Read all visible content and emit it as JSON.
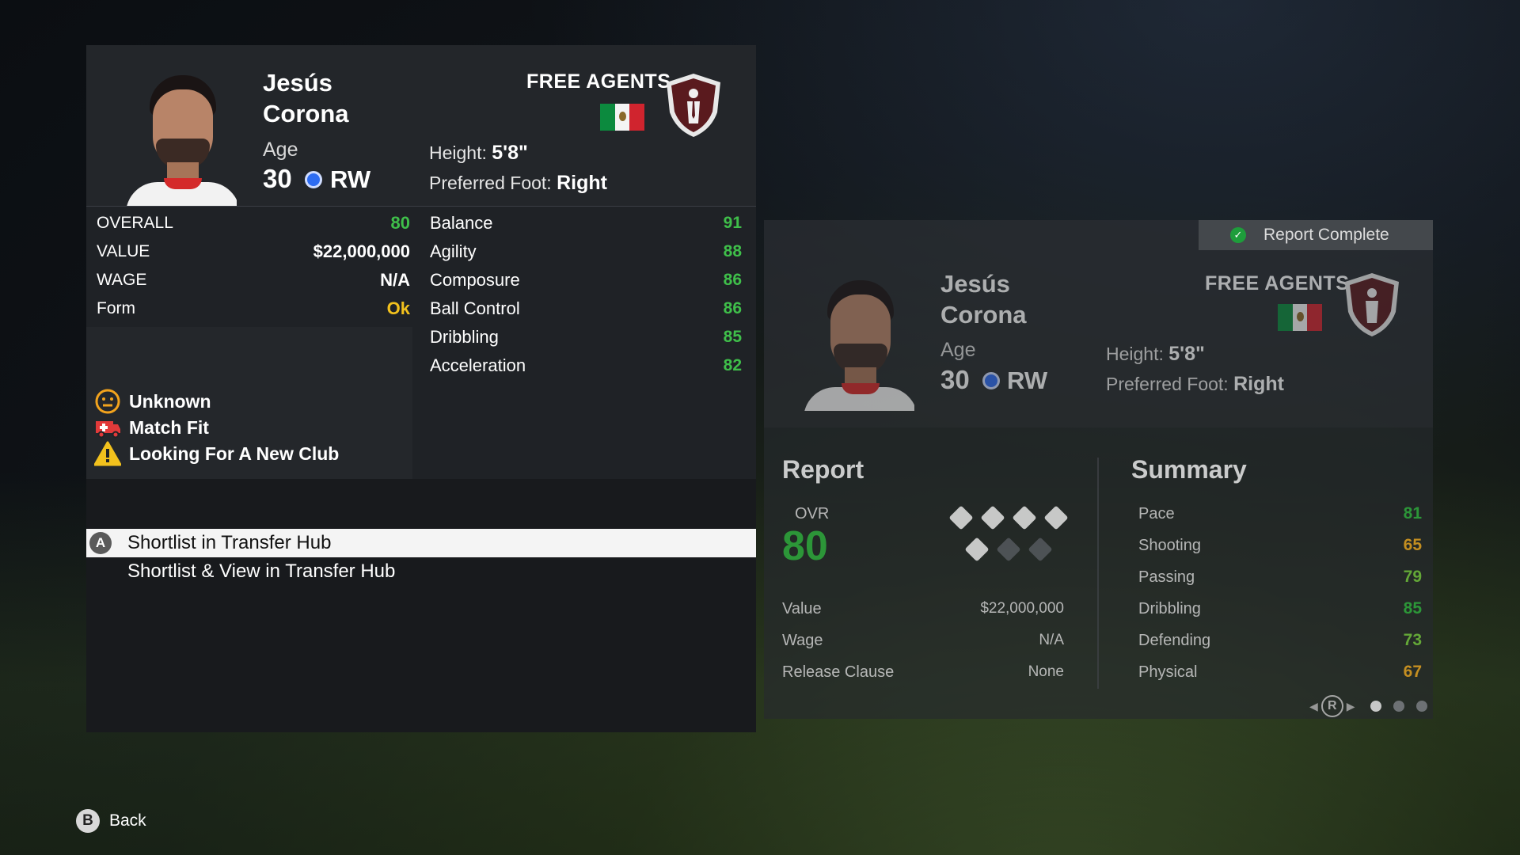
{
  "player": {
    "first_name": "Jesús",
    "last_name": "Corona",
    "age_label": "Age",
    "age": "30",
    "position": "RW",
    "club": "FREE AGENTS",
    "height_label": "Height:",
    "height": "5'8\"",
    "foot_label": "Preferred Foot:",
    "foot": "Right"
  },
  "overview": [
    {
      "label": "OVERALL",
      "value": "80",
      "color": "#3fbf4a"
    },
    {
      "label": "VALUE",
      "value": "$22,000,000",
      "color": "#ffffff"
    },
    {
      "label": "WAGE",
      "value": "N/A",
      "color": "#ffffff"
    },
    {
      "label": "Form",
      "value": "Ok",
      "color": "#f2c11d"
    }
  ],
  "attributes": [
    {
      "label": "Balance",
      "value": "91"
    },
    {
      "label": "Agility",
      "value": "88"
    },
    {
      "label": "Composure",
      "value": "86"
    },
    {
      "label": "Ball Control",
      "value": "86"
    },
    {
      "label": "Dribbling",
      "value": "85"
    },
    {
      "label": "Acceleration",
      "value": "82"
    }
  ],
  "status": [
    {
      "icon": "smiley-icon",
      "label": "Unknown"
    },
    {
      "icon": "ambulance-icon",
      "label": "Match Fit"
    },
    {
      "icon": "warning-icon",
      "label": "Looking For A New Club"
    }
  ],
  "actions": [
    {
      "label": "Shortlist in Transfer Hub",
      "button": "A"
    },
    {
      "label": "Shortlist & View in Transfer Hub"
    }
  ],
  "report_card": {
    "badge": "Report Complete",
    "report_title": "Report",
    "summary_title": "Summary",
    "ovr_label": "OVR",
    "ovr": "80",
    "rows": [
      {
        "label": "Value",
        "value": "$22,000,000"
      },
      {
        "label": "Wage",
        "value": "N/A"
      },
      {
        "label": "Release Clause",
        "value": "None"
      }
    ],
    "summary": [
      {
        "label": "Pace",
        "value": "81",
        "color": "#2eaa3c"
      },
      {
        "label": "Shooting",
        "value": "65",
        "color": "#e0a020"
      },
      {
        "label": "Passing",
        "value": "79",
        "color": "#6fbe3a"
      },
      {
        "label": "Dribbling",
        "value": "85",
        "color": "#2eaa3c"
      },
      {
        "label": "Defending",
        "value": "73",
        "color": "#6fbe3a"
      },
      {
        "label": "Physical",
        "value": "67",
        "color": "#e0a020"
      }
    ],
    "nav_button": "R"
  },
  "footer": {
    "back_button": "B",
    "back_label": "Back"
  },
  "colors": {
    "green": "#3fbf4a",
    "yellow": "#f2c11d",
    "position_dot": "#2d6cf2",
    "crest": "#5a1a1e"
  }
}
